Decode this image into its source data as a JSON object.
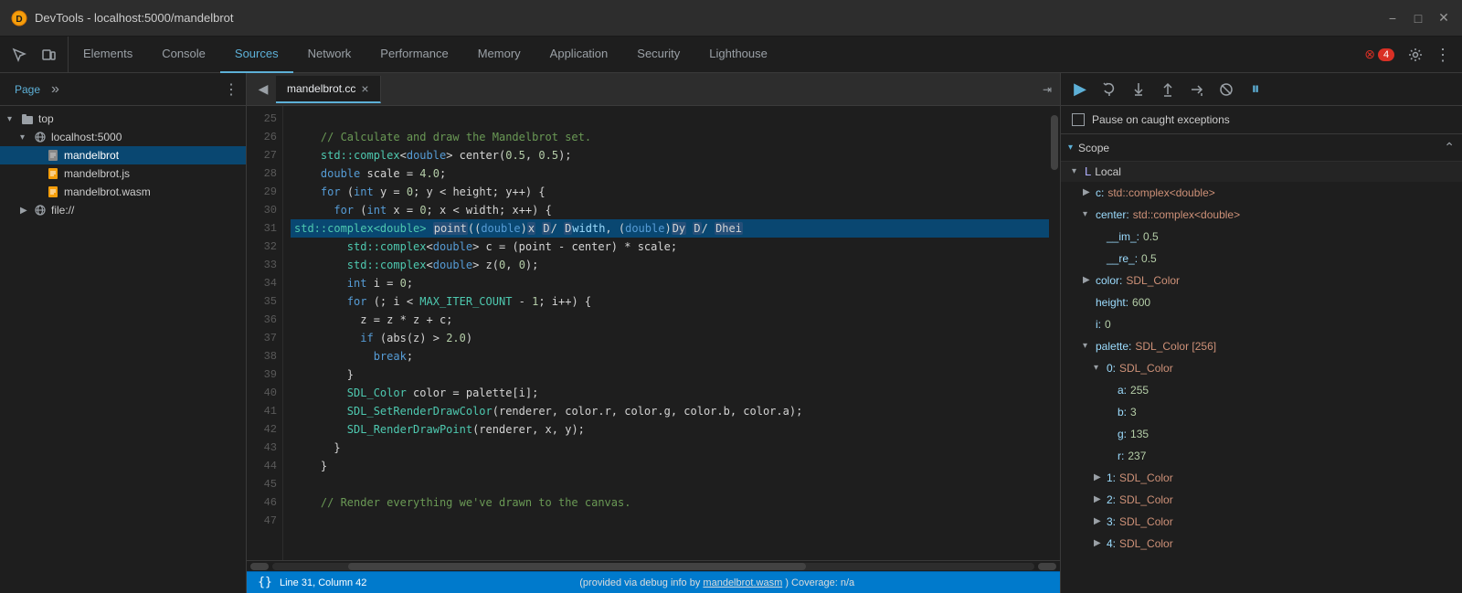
{
  "titlebar": {
    "title": "DevTools - localhost:5000/mandelbrot",
    "icon": "devtools-icon",
    "minimize": "−",
    "maximize": "□",
    "close": "✕"
  },
  "nav": {
    "tabs": [
      {
        "label": "Elements",
        "active": false
      },
      {
        "label": "Console",
        "active": false
      },
      {
        "label": "Sources",
        "active": true
      },
      {
        "label": "Network",
        "active": false
      },
      {
        "label": "Performance",
        "active": false
      },
      {
        "label": "Memory",
        "active": false
      },
      {
        "label": "Application",
        "active": false
      },
      {
        "label": "Security",
        "active": false
      },
      {
        "label": "Lighthouse",
        "active": false
      }
    ],
    "badge_count": "4",
    "settings_label": "⚙",
    "more_label": "⋮"
  },
  "left_panel": {
    "tab_page": "Page",
    "tab_more": "»",
    "menu": "⋮",
    "tree": [
      {
        "level": 0,
        "label": "top",
        "type": "folder",
        "expanded": true,
        "arrow": "▾"
      },
      {
        "level": 1,
        "label": "localhost:5000",
        "type": "network",
        "expanded": true,
        "arrow": "▾"
      },
      {
        "level": 2,
        "label": "mandelbrot",
        "type": "file-gray",
        "expanded": false,
        "arrow": ""
      },
      {
        "level": 2,
        "label": "mandelbrot.js",
        "type": "file-yellow",
        "expanded": false,
        "arrow": ""
      },
      {
        "level": 2,
        "label": "mandelbrot.wasm",
        "type": "file-yellow",
        "expanded": false,
        "arrow": ""
      },
      {
        "level": 1,
        "label": "file://",
        "type": "network",
        "expanded": false,
        "arrow": "▶"
      }
    ]
  },
  "editor": {
    "tab_back": "◀",
    "tab_name": "mandelbrot.cc",
    "tab_close": "×",
    "expand_icon": "⇥",
    "lines": [
      {
        "num": 25,
        "code": "",
        "highlighted": false
      },
      {
        "num": 26,
        "code": "    // Calculate and draw the Mandelbrot set.",
        "highlighted": false,
        "comment": true
      },
      {
        "num": 27,
        "code": "    std::complex<double> center(0.5, 0.5);",
        "highlighted": false
      },
      {
        "num": 28,
        "code": "    double scale = 4.0;",
        "highlighted": false
      },
      {
        "num": 29,
        "code": "    for (int y = 0; y < height; y++) {",
        "highlighted": false
      },
      {
        "num": 30,
        "code": "      for (int x = 0; x < width; x++) {",
        "highlighted": false
      },
      {
        "num": 31,
        "code": "        std::complex<double> point((double)x / width, (double)y / hei",
        "highlighted": true
      },
      {
        "num": 32,
        "code": "        std::complex<double> c = (point - center) * scale;",
        "highlighted": false
      },
      {
        "num": 33,
        "code": "        std::complex<double> z(0, 0);",
        "highlighted": false
      },
      {
        "num": 34,
        "code": "        int i = 0;",
        "highlighted": false
      },
      {
        "num": 35,
        "code": "        for (; i < MAX_ITER_COUNT - 1; i++) {",
        "highlighted": false
      },
      {
        "num": 36,
        "code": "          z = z * z + c;",
        "highlighted": false
      },
      {
        "num": 37,
        "code": "          if (abs(z) > 2.0)",
        "highlighted": false
      },
      {
        "num": 38,
        "code": "            break;",
        "highlighted": false
      },
      {
        "num": 39,
        "code": "        }",
        "highlighted": false
      },
      {
        "num": 40,
        "code": "        SDL_Color color = palette[i];",
        "highlighted": false
      },
      {
        "num": 41,
        "code": "        SDL_SetRenderDrawColor(renderer, color.r, color.g, color.b, color.a);",
        "highlighted": false
      },
      {
        "num": 42,
        "code": "        SDL_RenderDrawPoint(renderer, x, y);",
        "highlighted": false
      },
      {
        "num": 43,
        "code": "      }",
        "highlighted": false
      },
      {
        "num": 44,
        "code": "    }",
        "highlighted": false
      },
      {
        "num": 45,
        "code": "",
        "highlighted": false
      },
      {
        "num": 46,
        "code": "    // Render everything we've drawn to the canvas.",
        "highlighted": false,
        "comment": true
      },
      {
        "num": 47,
        "code": "",
        "highlighted": false
      }
    ]
  },
  "status": {
    "format_icon": "{}",
    "position": "Line 31, Column 42",
    "source_info": "(provided via debug info by",
    "source_link": "mandelbrot.wasm",
    "coverage": ") Coverage: n/a"
  },
  "debugger": {
    "resume_icon": "▶",
    "step_over_icon": "↷",
    "step_into_icon": "↓",
    "step_out_icon": "↑",
    "step_icon": "→",
    "deactivate_icon": "⊘",
    "pause_icon": "⏸",
    "exceptions_label": "Pause on caught exceptions",
    "scope_title": "Scope",
    "scope_collapse": "⌃",
    "scope_local_label": "Local",
    "scope_items": [
      {
        "indent": 1,
        "arrow": "▶",
        "key": "c:",
        "val": "std::complex<double>",
        "type": "type"
      },
      {
        "indent": 1,
        "arrow": "▾",
        "key": "center:",
        "val": "std::complex<double>",
        "type": "type"
      },
      {
        "indent": 2,
        "arrow": "",
        "key": "__im_:",
        "val": "0.5",
        "type": "num"
      },
      {
        "indent": 2,
        "arrow": "",
        "key": "__re_:",
        "val": "0.5",
        "type": "num"
      },
      {
        "indent": 1,
        "arrow": "▶",
        "key": "color:",
        "val": "SDL_Color",
        "type": "type"
      },
      {
        "indent": 1,
        "arrow": "",
        "key": "height:",
        "val": "600",
        "type": "num"
      },
      {
        "indent": 1,
        "arrow": "",
        "key": "i:",
        "val": "0",
        "type": "num"
      },
      {
        "indent": 1,
        "arrow": "▾",
        "key": "palette:",
        "val": "SDL_Color [256]",
        "type": "type"
      },
      {
        "indent": 2,
        "arrow": "▾",
        "key": "0:",
        "val": "SDL_Color",
        "type": "type"
      },
      {
        "indent": 3,
        "arrow": "",
        "key": "a:",
        "val": "255",
        "type": "num"
      },
      {
        "indent": 3,
        "arrow": "",
        "key": "b:",
        "val": "3",
        "type": "num"
      },
      {
        "indent": 3,
        "arrow": "",
        "key": "g:",
        "val": "135",
        "type": "num"
      },
      {
        "indent": 3,
        "arrow": "",
        "key": "r:",
        "val": "237",
        "type": "num"
      },
      {
        "indent": 2,
        "arrow": "▶",
        "key": "1:",
        "val": "SDL_Color",
        "type": "type"
      },
      {
        "indent": 2,
        "arrow": "▶",
        "key": "2:",
        "val": "SDL_Color",
        "type": "type"
      },
      {
        "indent": 2,
        "arrow": "▶",
        "key": "3:",
        "val": "SDL_Color",
        "type": "type"
      },
      {
        "indent": 2,
        "arrow": "▶",
        "key": "4:",
        "val": "SDL_Color",
        "type": "type"
      }
    ]
  }
}
